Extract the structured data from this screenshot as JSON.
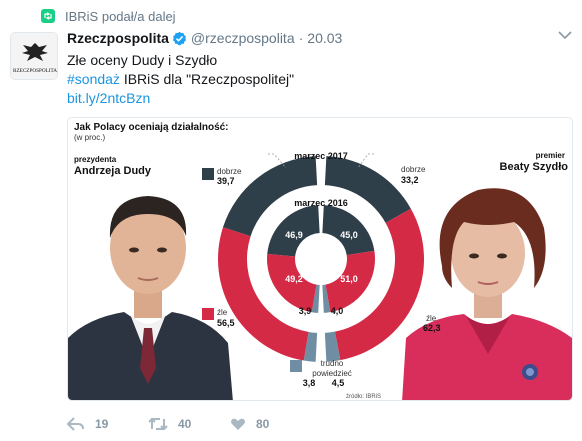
{
  "retweet": {
    "text": "IBRiS podał/a dalej"
  },
  "tweet": {
    "name": "Rzeczpospolita",
    "handle": "@rzeczpospolita",
    "separator": "·",
    "date": "20.03",
    "text_line1": "Złe oceny Dudy i Szydło",
    "hashtag": "#sondaż",
    "text_line2_rest": " IBRiS dla \"Rzeczpospolitej\"",
    "link": "bit.ly/2ntcBzn",
    "avatar_text": "RZECZPOSPOLITA"
  },
  "infographic": {
    "title": "Jak Polacy oceniają działalność:",
    "subtitle": "(w proc.)",
    "left_person_role": "prezydenta",
    "left_person_name": "Andrzeja Dudy",
    "right_person_role": "premier",
    "right_person_name": "Beaty Szydło",
    "outer_ring_label": "marzec 2017",
    "inner_ring_label": "marzec 2016",
    "cat_good": "dobrze",
    "cat_bad": "źle",
    "cat_unsure_1": "trudno",
    "cat_unsure_2": "powiedzieć",
    "source": "źródło: IBRiS",
    "colors": {
      "good": "#2f3f4a",
      "bad": "#d42a46",
      "unsure": "#6f8da3"
    }
  },
  "chart_data": [
    {
      "type": "pie",
      "title": "marzec 2017",
      "series": [
        {
          "name": "Andrzeja Dudy",
          "categories": [
            "dobrze",
            "źle",
            "trudno powiedzieć"
          ],
          "values": [
            39.7,
            56.5,
            3.8
          ]
        },
        {
          "name": "Beaty Szydło",
          "categories": [
            "dobrze",
            "źle",
            "trudno powiedzieć"
          ],
          "values": [
            33.2,
            62.3,
            4.5
          ]
        }
      ]
    },
    {
      "type": "pie",
      "title": "marzec 2016",
      "series": [
        {
          "name": "Andrzeja Dudy",
          "categories": [
            "dobrze",
            "źle",
            "trudno powiedzieć"
          ],
          "values": [
            46.9,
            49.2,
            3.9
          ]
        },
        {
          "name": "Beaty Szydło",
          "categories": [
            "dobrze",
            "źle",
            "trudno powiedzieć"
          ],
          "values": [
            45.0,
            51.0,
            4.0
          ]
        }
      ]
    }
  ],
  "values_text": {
    "duda_2017_good": "39,7",
    "duda_2017_bad": "56,5",
    "duda_2017_unsure": "3,8",
    "szydlo_2017_good": "33,2",
    "szydlo_2017_bad": "62,3",
    "szydlo_2017_unsure": "4,5",
    "duda_2016_good": "46,9",
    "duda_2016_bad": "49,2",
    "duda_2016_unsure": "3,9",
    "szydlo_2016_good": "45,0",
    "szydlo_2016_bad": "51,0",
    "szydlo_2016_unsure": "4,0"
  },
  "actions": {
    "reply_count": "19",
    "retweet_count": "40",
    "like_count": "80"
  }
}
